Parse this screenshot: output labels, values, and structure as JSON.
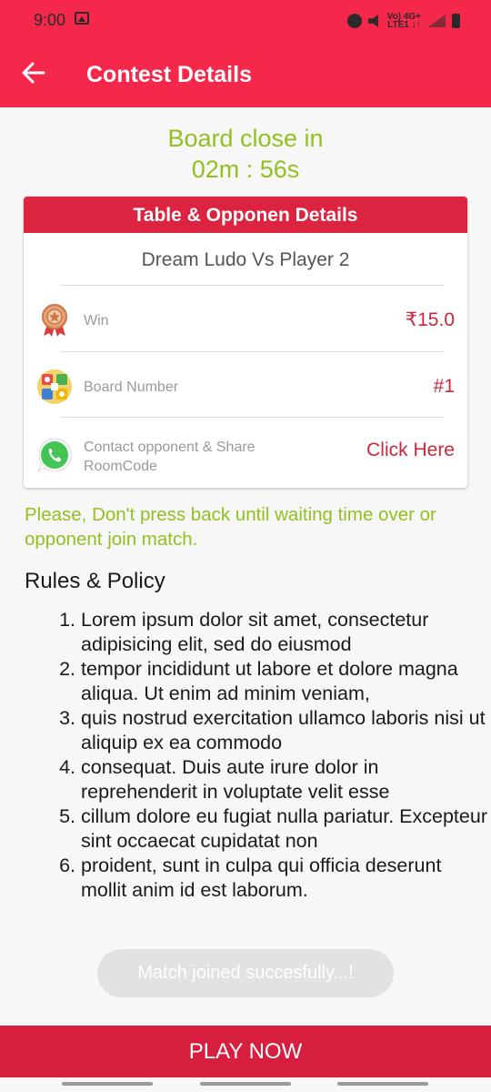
{
  "status_bar": {
    "time": "9:00",
    "net_label_1": "Vo) 4G+",
    "net_label_2": "LTE1 ↓↑"
  },
  "app_bar": {
    "title": "Contest Details"
  },
  "timer": {
    "label": "Board close in",
    "value": "02m : 56s"
  },
  "details_card": {
    "header": "Table & Opponen Details",
    "match_title": "Dream Ludo Vs Player 2",
    "rows": [
      {
        "icon": "medal-icon",
        "label": "Win",
        "value": "₹15.0"
      },
      {
        "icon": "ludo-board-icon",
        "label": "Board Number",
        "value": "#1"
      },
      {
        "icon": "whatsapp-icon",
        "label": "Contact opponent & Share RoomCode",
        "value": "Click Here"
      }
    ]
  },
  "warning": "Please, Don't press back until waiting time over or opponent join match.",
  "rules": {
    "title": "Rules & Policy",
    "items": [
      "Lorem ipsum dolor sit amet, consectetur adipisicing elit, sed do eiusmod",
      "tempor incididunt ut labore et dolore magna aliqua. Ut enim ad minim veniam,",
      "quis nostrud exercitation ullamco laboris nisi ut aliquip ex ea commodo",
      "consequat. Duis aute irure dolor in reprehenderit in voluptate velit esse",
      "cillum dolore eu fugiat nulla pariatur. Excepteur sint occaecat cupidatat non",
      "proident, sunt in culpa qui officia deserunt mollit anim id est laborum."
    ]
  },
  "toast": "Match joined succesfully...!",
  "play_button": "PLAY NOW",
  "colors": {
    "primary": "#f5284c",
    "accent_green": "#93c01f",
    "value_red": "#c9283e",
    "play_red": "#d81e3e"
  }
}
